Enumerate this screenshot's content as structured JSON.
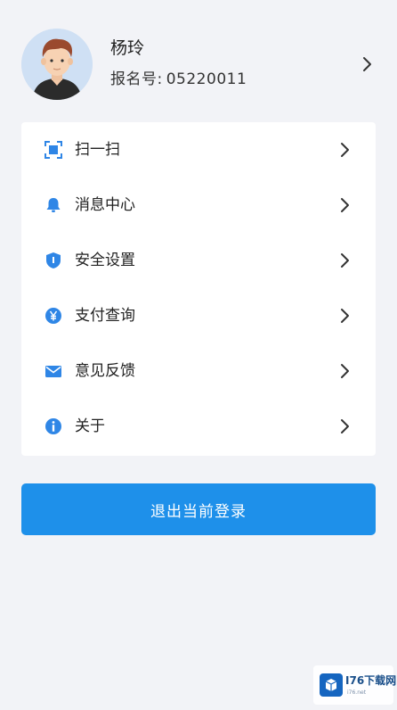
{
  "profile": {
    "name": "杨玲",
    "id_label": "报名号:",
    "id_value": "05220011"
  },
  "menu": {
    "items": [
      {
        "label": "扫一扫",
        "icon": "scan-icon"
      },
      {
        "label": "消息中心",
        "icon": "bell-icon"
      },
      {
        "label": "安全设置",
        "icon": "shield-icon"
      },
      {
        "label": "支付查询",
        "icon": "yen-icon"
      },
      {
        "label": "意见反馈",
        "icon": "mail-icon"
      },
      {
        "label": "关于",
        "icon": "info-icon"
      }
    ]
  },
  "logout": {
    "label": "退出当前登录"
  },
  "watermark": {
    "text": "I76下载网",
    "sub": "i76.net"
  },
  "colors": {
    "accent": "#1e90ea",
    "icon": "#2f86e6",
    "background": "#f2f3f7"
  }
}
